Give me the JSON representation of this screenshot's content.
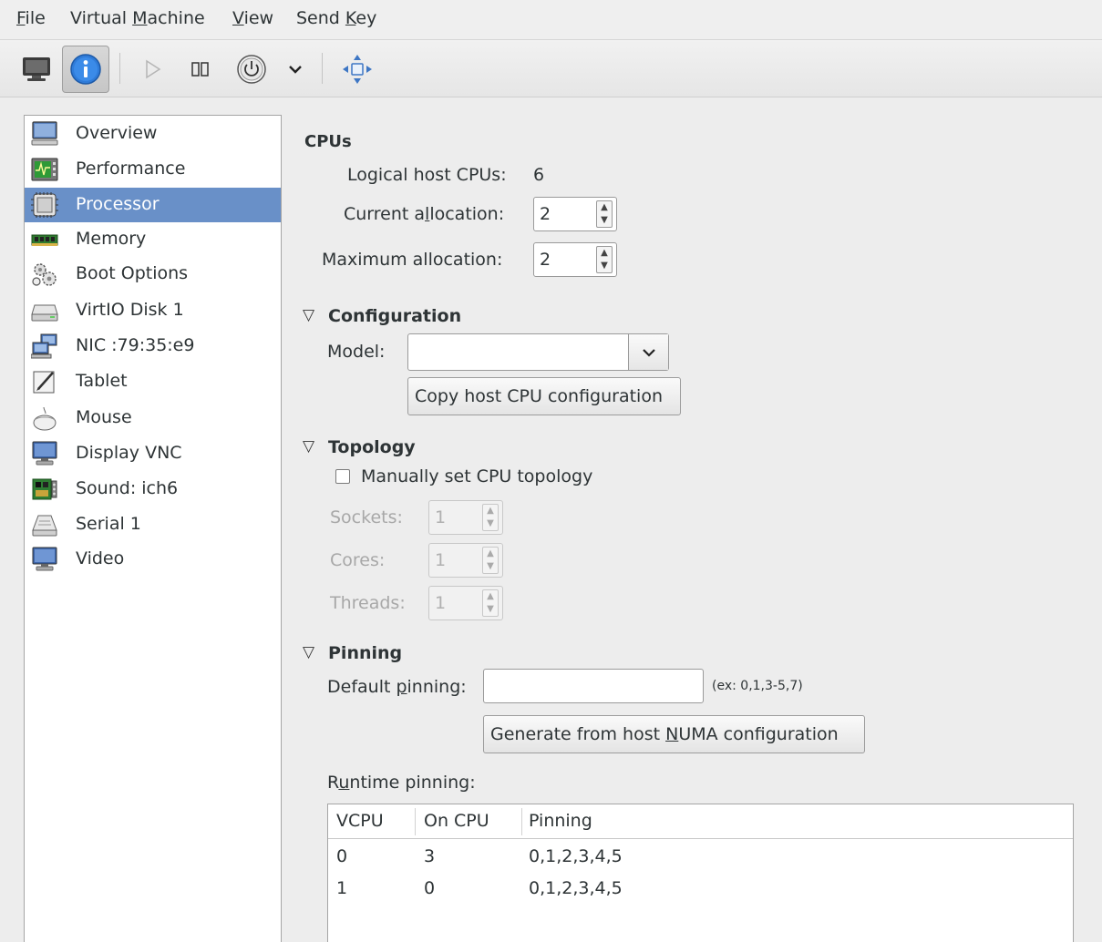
{
  "menubar": {
    "file": "File",
    "virtual_machine": "Virtual Machine",
    "view": "View",
    "send_key": "Send Key"
  },
  "toolbar": {
    "icons": [
      "console-monitor-icon",
      "details-info-icon",
      "run-play-icon",
      "pause-icon",
      "shutdown-power-icon",
      "shutdown-menu-chevron-icon",
      "fullscreen-move-icon"
    ]
  },
  "sidebar": {
    "selected": "Processor",
    "items": [
      {
        "label": "Overview",
        "icon": "overview-monitor-icon"
      },
      {
        "label": "Performance",
        "icon": "performance-chart-icon"
      },
      {
        "label": "Processor",
        "icon": "processor-chip-icon"
      },
      {
        "label": "Memory",
        "icon": "memory-ram-icon"
      },
      {
        "label": "Boot Options",
        "icon": "boot-gears-icon"
      },
      {
        "label": "VirtIO Disk 1",
        "icon": "disk-drive-icon"
      },
      {
        "label": "NIC :79:35:e9",
        "icon": "network-nic-icon"
      },
      {
        "label": "Tablet",
        "icon": "tablet-pen-icon"
      },
      {
        "label": "Mouse",
        "icon": "mouse-icon"
      },
      {
        "label": "Display VNC",
        "icon": "display-monitor-icon"
      },
      {
        "label": "Sound: ich6",
        "icon": "sound-card-icon"
      },
      {
        "label": "Serial 1",
        "icon": "serial-port-icon"
      },
      {
        "label": "Video",
        "icon": "video-monitor-icon"
      }
    ]
  },
  "cpus": {
    "heading": "CPUs",
    "logical_label": "Logical host CPUs:",
    "logical_value": "6",
    "current_label": "Current allocation:",
    "current_value": "2",
    "maximum_label": "Maximum allocation:",
    "maximum_value": "2"
  },
  "configuration": {
    "heading": "Configuration",
    "model_label": "Model:",
    "model_value": "",
    "copy_button": "Copy host CPU configuration"
  },
  "topology": {
    "heading": "Topology",
    "manual_checkbox_label": "Manually set CPU topology",
    "manual_checked": false,
    "sockets_label": "Sockets:",
    "sockets_value": "1",
    "cores_label": "Cores:",
    "cores_value": "1",
    "threads_label": "Threads:",
    "threads_value": "1"
  },
  "pinning": {
    "heading": "Pinning",
    "default_label": "Default pinning:",
    "default_value": "",
    "example_hint": "(ex: 0,1,3-5,7)",
    "generate_button": "Generate from host NUMA configuration",
    "runtime_label": "Runtime pinning:",
    "columns": [
      "VCPU",
      "On CPU",
      "Pinning"
    ],
    "rows": [
      {
        "vcpu": "0",
        "on_cpu": "3",
        "pinning": "0,1,2,3,4,5"
      },
      {
        "vcpu": "1",
        "on_cpu": "0",
        "pinning": "0,1,2,3,4,5"
      }
    ]
  }
}
